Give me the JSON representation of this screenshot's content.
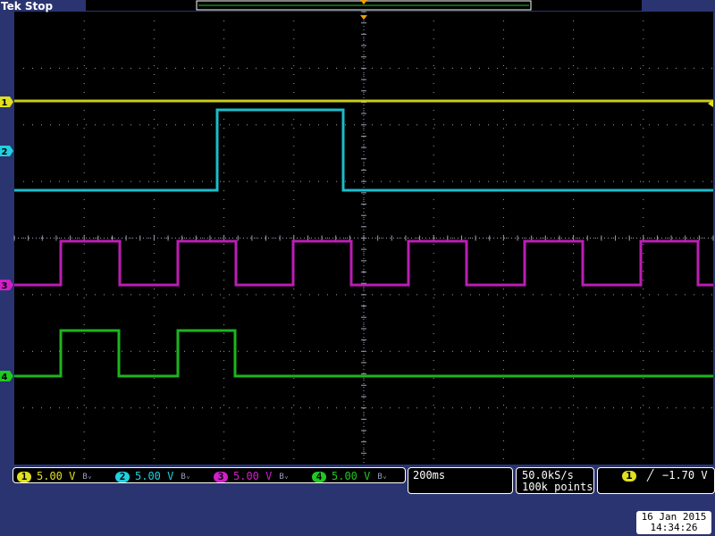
{
  "header": {
    "status": "Tek Stop"
  },
  "colors": {
    "ch1": "#e0e020",
    "ch2": "#20d0e0",
    "ch3": "#d020c8",
    "ch4": "#20c820",
    "marker_orange": "#f0a000",
    "frame_bg": "#2a3470",
    "grid": "#9aa0b0"
  },
  "channels": [
    {
      "id": "1",
      "scale": "5.00 V",
      "bandwidth_icon": "Bᵥ"
    },
    {
      "id": "2",
      "scale": "5.00 V",
      "bandwidth_icon": "Bᵥ"
    },
    {
      "id": "3",
      "scale": "5.00 V",
      "bandwidth_icon": "Bᵥ"
    },
    {
      "id": "4",
      "scale": "5.00 V",
      "bandwidth_icon": "Bᵥ"
    }
  ],
  "horizontal": {
    "timebase": "200ms",
    "sample_rate": "50.0kS/s",
    "record_length": "100k points"
  },
  "trigger": {
    "source": "1",
    "slope_icon": "rising-edge",
    "level": "−1.70 V"
  },
  "datetime": {
    "date": "16 Jan  2015",
    "time": "14:34:26"
  }
}
